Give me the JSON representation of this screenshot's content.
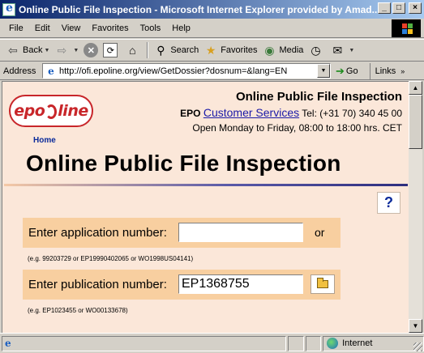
{
  "window": {
    "title": "Online Public File Inspection - Microsoft Internet Explorer provided by Amad...",
    "minimize": "_",
    "maximize": "□",
    "close": "×"
  },
  "menu": {
    "items": [
      "File",
      "Edit",
      "View",
      "Favorites",
      "Tools",
      "Help"
    ]
  },
  "toolbar": {
    "back": "Back",
    "search": "Search",
    "favorites": "Favorites",
    "media": "Media"
  },
  "address": {
    "label": "Address",
    "url": "http://ofi.epoline.org/view/GetDossier?dosnum=&lang=EN",
    "go": "Go",
    "links": "Links"
  },
  "page": {
    "logo_text_left": "epo",
    "logo_text_right": "line",
    "home_link": "Home",
    "header_title": "Online Public File Inspection",
    "contact_prefix": "EPO",
    "contact_link": "Customer Services",
    "contact_tel": "Tel: (+31 70) 340 45 00",
    "hours": "Open Monday to Friday, 08:00 to 18:00 hrs. CET",
    "main_title": "Online Public File Inspection",
    "help": "?",
    "app_label": "Enter application number:",
    "app_value": "",
    "or_text": "or",
    "app_example": "(e.g. 99203729 or EP19990402065 or WO1998US04141)",
    "pub_label": "Enter publication number:",
    "pub_value": "EP1368755",
    "pub_example": "(e.g. EP1023455 or WO00133678)"
  },
  "status": {
    "zone": "Internet"
  },
  "colors": {
    "page_background": "#fbe7d9",
    "form_band": "#f8cfa0",
    "brand_red": "#c8262a",
    "link_blue": "#1a1aa8"
  }
}
